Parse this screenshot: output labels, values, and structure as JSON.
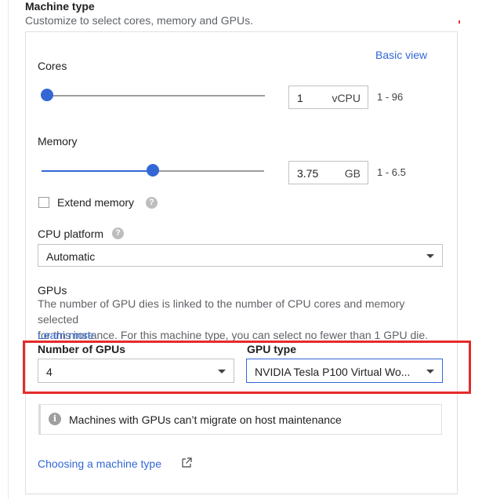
{
  "section": {
    "title": "Machine type",
    "subtitle": "Customize to select cores, memory and GPUs."
  },
  "basic_view_link": "Basic view",
  "cores": {
    "label": "Cores",
    "value": "1",
    "unit": "vCPU",
    "range": "1 - 96",
    "slider_fraction": 0.0
  },
  "memory": {
    "label": "Memory",
    "value": "3.75",
    "unit": "GB",
    "range": "1 - 6.5",
    "slider_fraction": 0.5
  },
  "extend_memory": {
    "label": "Extend memory",
    "checked": false,
    "help_icon": "help-circle-icon"
  },
  "cpu_platform": {
    "label": "CPU platform",
    "selected": "Automatic",
    "help_icon": "help-circle-icon"
  },
  "gpus": {
    "heading": "GPUs",
    "description_line1": "The number of GPU dies is linked to the number of CPU cores and memory selected",
    "description_line2": "for this instance. For this machine type, you can select no fewer than 1 GPU die.",
    "learn_more": "Learn more",
    "count_label": "Number of GPUs",
    "count_selected": "4",
    "type_label": "GPU type",
    "type_selected": "NVIDIA Tesla P100 Virtual Wo..."
  },
  "notice": {
    "icon": "info-icon",
    "text": "Machines with GPUs can’t migrate on host maintenance"
  },
  "footer_link": {
    "label": "Choosing a machine type",
    "icon": "open-in-new-icon"
  },
  "colors": {
    "accent": "#3367d6",
    "highlight": "#e52b2b"
  }
}
